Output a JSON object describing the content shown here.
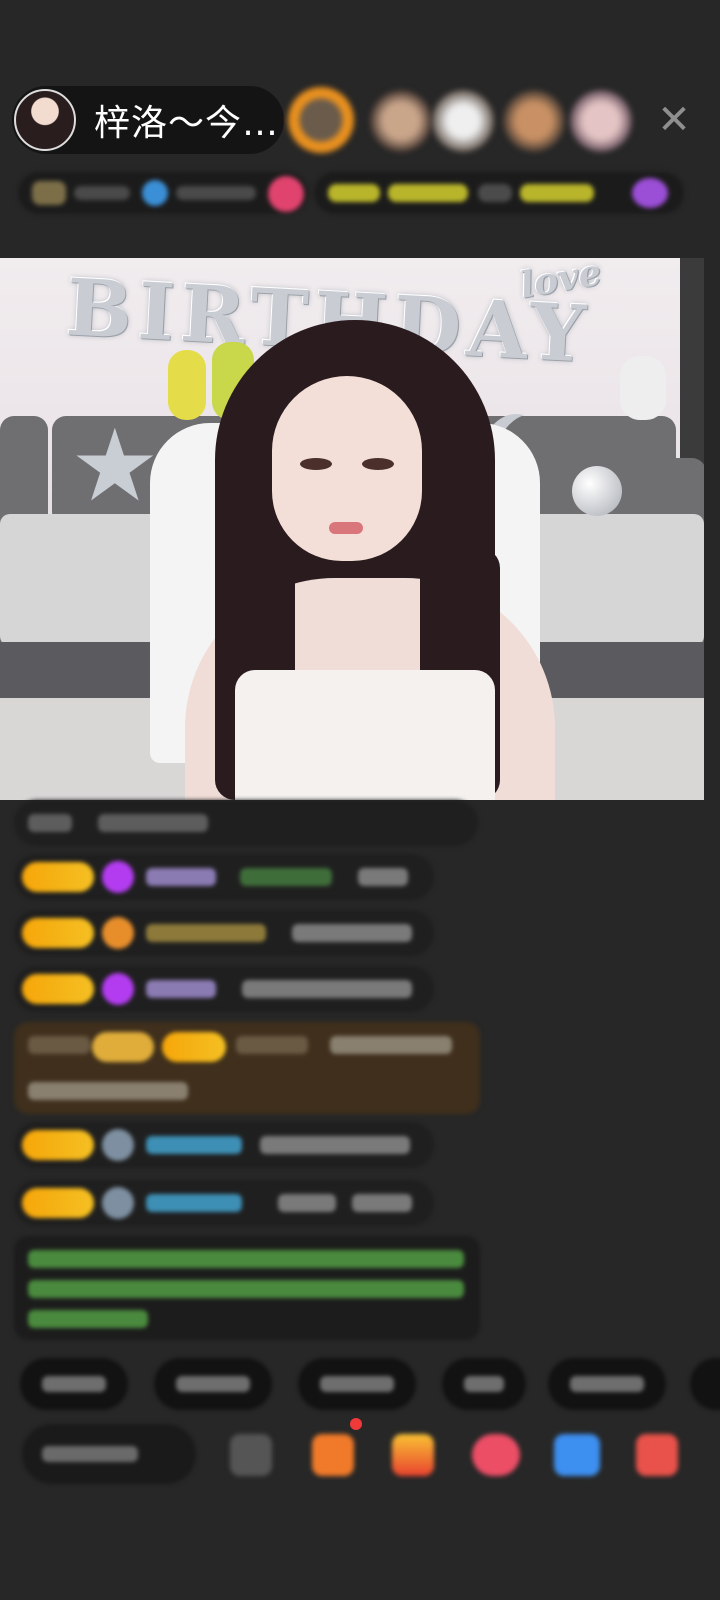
{
  "header": {
    "host_name": "梓洛～今…",
    "close_icon": "close-icon",
    "close_glyph": "✕"
  },
  "video": {
    "balloon_text": "BIRTHDAY",
    "love_text": "love"
  },
  "colors": {
    "background": "#272727",
    "badge_gold": "#f6a609",
    "gem_purple": "#b33cf0",
    "highlight_bg": "#3f2f1c",
    "system_text_green": "#5cc04a",
    "notification_red": "#f03a3a"
  }
}
